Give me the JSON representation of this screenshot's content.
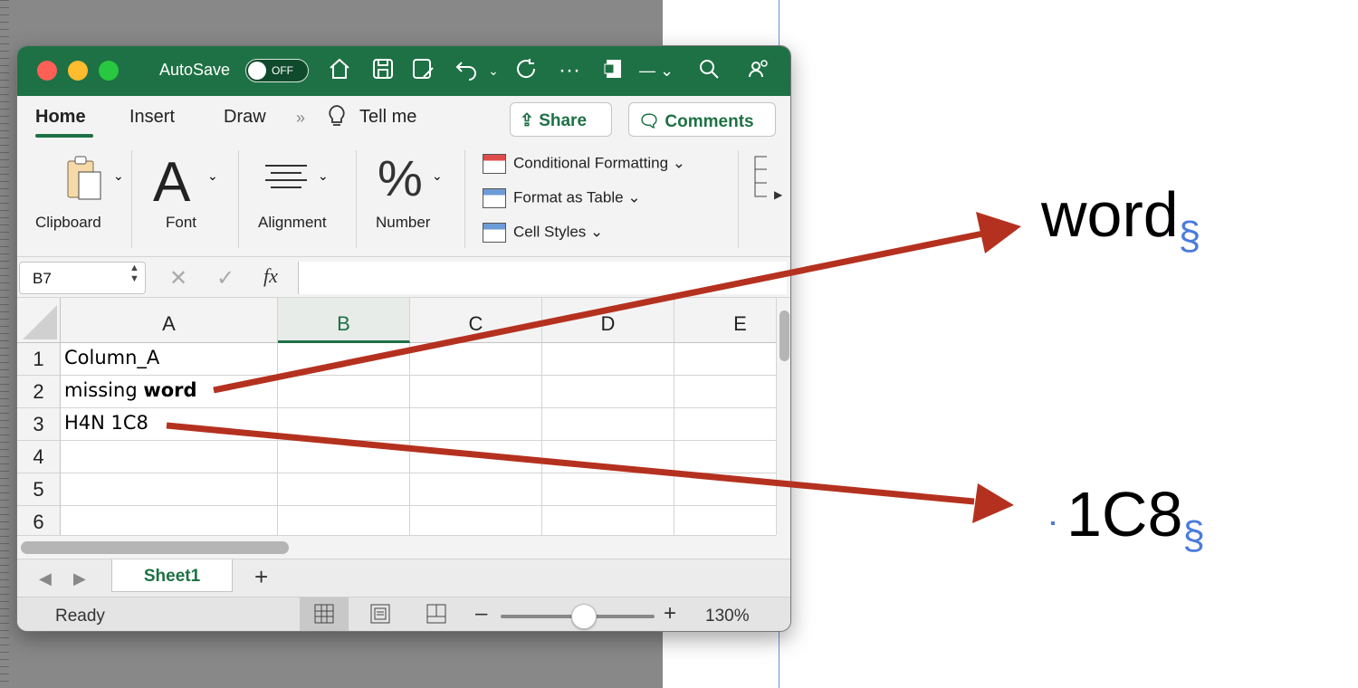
{
  "titlebar": {
    "autosave_label": "AutoSave",
    "autosave_state": "OFF",
    "icons": [
      "home-icon",
      "save-icon",
      "save-as-icon",
      "undo-icon",
      "redo-icon",
      "more-icon",
      "excel-doc-icon",
      "search-icon",
      "people-icon"
    ]
  },
  "ribbon": {
    "tabs": [
      {
        "label": "Home",
        "active": true
      },
      {
        "label": "Insert"
      },
      {
        "label": "Draw"
      }
    ],
    "more_glyph": "»",
    "tell_me": "Tell me",
    "share_label": "Share",
    "comments_label": "Comments",
    "groups": {
      "clipboard": "Clipboard",
      "font": "Font",
      "alignment": "Alignment",
      "number": "Number"
    },
    "styles": [
      "Conditional Formatting",
      "Format as Table",
      "Cell Styles"
    ]
  },
  "formula_bar": {
    "name_box": "B7",
    "fx_label": "fx",
    "formula": ""
  },
  "grid": {
    "columns": [
      "A",
      "B",
      "C",
      "D",
      "E"
    ],
    "selected_column": "B",
    "rows": [
      "1",
      "2",
      "3",
      "4",
      "5",
      "6"
    ],
    "cells": {
      "A1": "Column_A",
      "A2_plain": "missing ",
      "A2_bold": "word",
      "A3": "H4N 1C8"
    }
  },
  "sheets": {
    "tabs": [
      "Sheet1"
    ],
    "add_label": "+"
  },
  "status_bar": {
    "status": "Ready",
    "zoom_level": "130%",
    "zoom_minus": "–",
    "zoom_plus": "+"
  },
  "document": {
    "callout_word": "word",
    "callout_1c8": "1C8",
    "para_mark": "§"
  },
  "colors": {
    "excel_green": "#1e7145",
    "arrow": "#b5311f",
    "para_mark": "#4a7bdc"
  }
}
